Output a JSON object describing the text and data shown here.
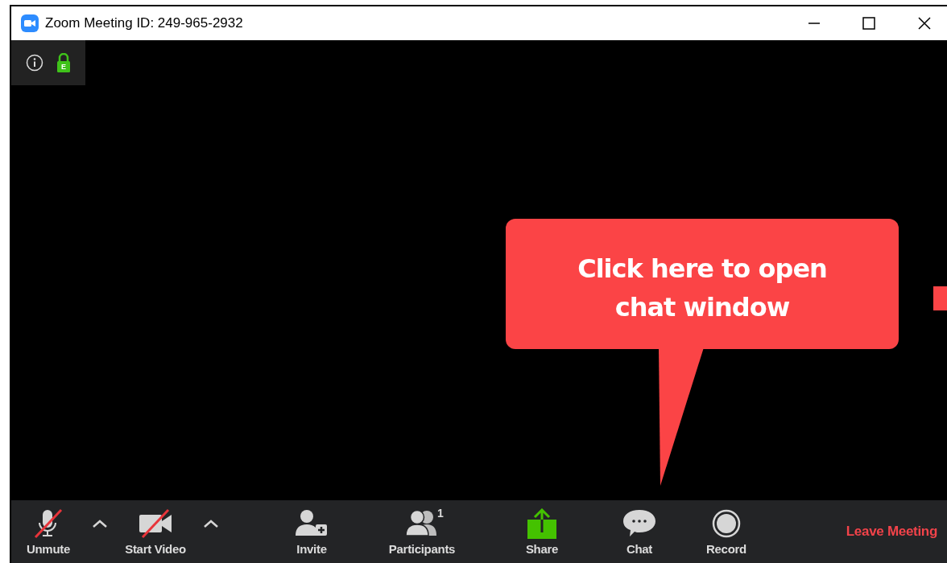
{
  "window": {
    "title": "Zoom Meeting ID: 249-965-2932"
  },
  "meeting_info": {
    "encryption_badge": "E"
  },
  "callout": {
    "text": "Click here to open chat window"
  },
  "toolbar": {
    "items": [
      {
        "kind": "mic",
        "label": "Unmute",
        "off": true,
        "menu": true
      },
      {
        "kind": "camera",
        "label": "Start Video",
        "off": true,
        "menu": true
      },
      {
        "kind": "invite",
        "label": "Invite"
      },
      {
        "kind": "participants",
        "label": "Participants",
        "count": "1"
      },
      {
        "kind": "share",
        "label": "Share"
      },
      {
        "kind": "chat",
        "label": "Chat"
      },
      {
        "kind": "record",
        "label": "Record"
      }
    ],
    "leave": "Leave Meeting"
  }
}
